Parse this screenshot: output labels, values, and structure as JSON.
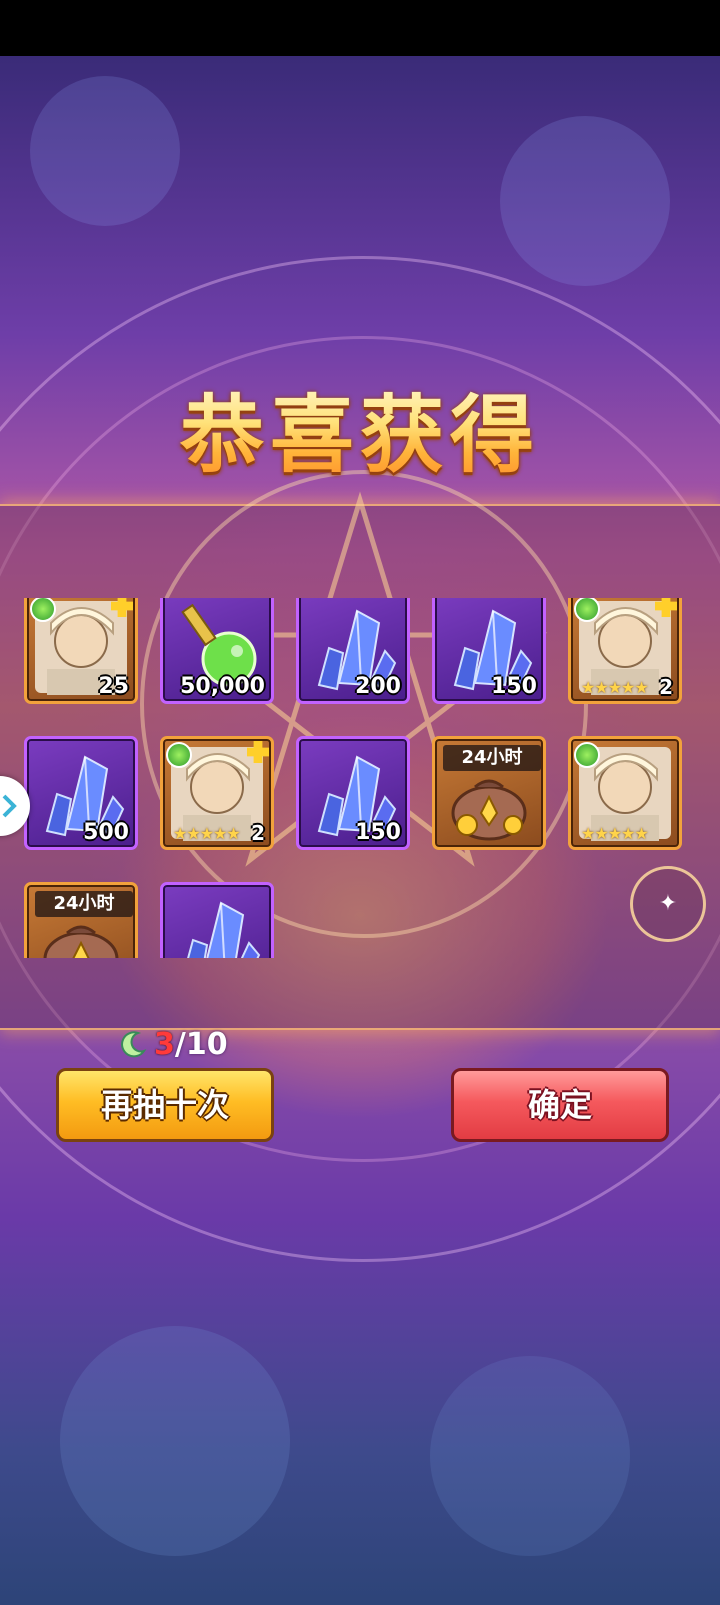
{
  "title": "恭喜获得",
  "rewards": [
    {
      "type": "hero-fragment",
      "frame": "orange",
      "quantity": "25"
    },
    {
      "type": "exp-potion",
      "frame": "purple",
      "quantity": "50,000"
    },
    {
      "type": "crystal",
      "frame": "purple",
      "quantity": "200"
    },
    {
      "type": "crystal",
      "frame": "purple",
      "quantity": "150"
    },
    {
      "type": "hero-fragment",
      "frame": "orange",
      "stars": "★★★★★",
      "quantity": "2"
    },
    {
      "type": "crystal",
      "frame": "purple",
      "quantity": "500"
    },
    {
      "type": "hero-fragment",
      "frame": "orange",
      "stars": "★★★★★",
      "quantity": "2"
    },
    {
      "type": "crystal",
      "frame": "purple",
      "quantity": "150"
    },
    {
      "type": "gold-bag",
      "frame": "orange",
      "tag": "24小时"
    },
    {
      "type": "hero",
      "frame": "orange",
      "stars": "★★★★★"
    },
    {
      "type": "gold-bag",
      "frame": "orange",
      "tag": "24小时"
    },
    {
      "type": "crystal",
      "frame": "purple"
    }
  ],
  "draw_counter": {
    "used": "3",
    "total": "/10",
    "icon": "moon-icon"
  },
  "buttons": {
    "draw_again": "再抽十次",
    "confirm": "确定"
  },
  "colors": {
    "accent_gold": "#ffbd24",
    "confirm_red": "#f5595d",
    "purple_frame": "#c262ff",
    "orange_frame": "#f2a23c"
  }
}
